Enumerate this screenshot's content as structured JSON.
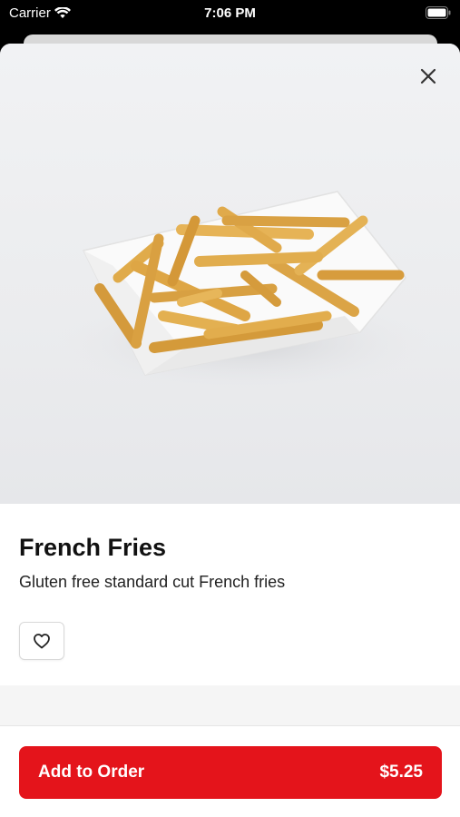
{
  "status_bar": {
    "carrier": "Carrier",
    "time": "7:06 PM"
  },
  "item": {
    "name": "French Fries",
    "description": "Gluten free standard cut French fries"
  },
  "footer": {
    "add_label": "Add to Order",
    "price": "$5.25"
  },
  "colors": {
    "accent": "#e4141b"
  },
  "icons": {
    "close": "close-icon",
    "favorite": "heart-outline-icon",
    "wifi": "wifi-icon",
    "battery": "battery-icon"
  }
}
